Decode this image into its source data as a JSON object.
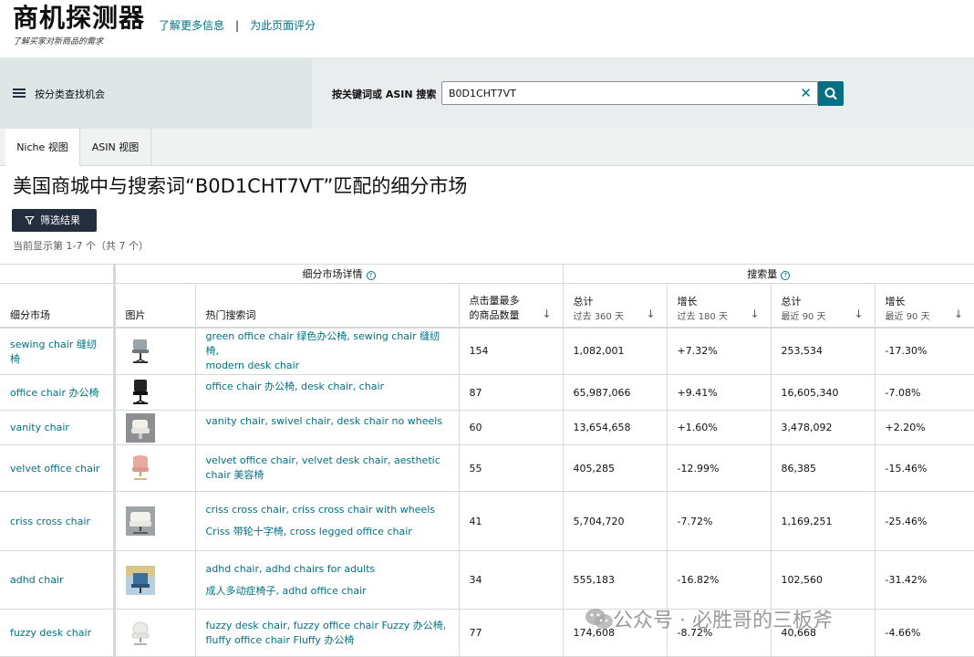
{
  "header": {
    "app_title": "商机探测器",
    "app_subtitle": "了解买家对新商品的需求",
    "link_learn_more": "了解更多信息",
    "separator": "|",
    "link_rate_page": "为此页面评分"
  },
  "search": {
    "category_label": "按分类查找机会",
    "keyword_label": "按关键词或 ASIN 搜索",
    "query_value": "B0D1CHT7VT",
    "clear_symbol": "✕"
  },
  "tabs": [
    {
      "label": "Niche 视图",
      "active": true
    },
    {
      "label": "ASIN 视图",
      "active": false
    }
  ],
  "results": {
    "title": "美国商城中与搜索词“B0D1CHT7VT”匹配的细分市场",
    "filter_button": "筛选结果",
    "showing_text": "当前显示第 1-7 个（共 7 个）"
  },
  "table": {
    "group_headers": {
      "niche_details": "细分市场详情",
      "search_volume": "搜索量"
    },
    "columns": {
      "niche": "细分市场",
      "image": "图片",
      "top_terms": "热门搜索词",
      "most_clicked_1": "点击量最多",
      "most_clicked_2": "的商品数量",
      "total_360": "总计",
      "total_360_sub": "过去 360 天",
      "growth_180": "增长",
      "growth_180_sub": "过去 180 天",
      "total_90": "总计",
      "total_90_sub": "最近 90 天",
      "growth_90": "增长",
      "growth_90_sub": "最近 90 天"
    },
    "rows": [
      {
        "niche": "sewing chair 缝纫椅",
        "terms_1": "green office chair 绿色办公椅, sewing chair 缝纫椅,",
        "terms_2": "modern desk chair",
        "clicked": "154",
        "total_360": "1,082,001",
        "growth_180": "+7.32%",
        "total_90": "253,534",
        "growth_90": "-17.30%"
      },
      {
        "niche": "office chair 办公椅",
        "terms_1": "office chair 办公椅, desk chair, chair",
        "terms_2": "",
        "clicked": "87",
        "total_360": "65,987,066",
        "growth_180": "+9.41%",
        "total_90": "16,605,340",
        "growth_90": "-7.08%"
      },
      {
        "niche": "vanity chair",
        "terms_1": "vanity chair, swivel chair, desk chair no wheels",
        "terms_2": "",
        "clicked": "60",
        "total_360": "13,654,658",
        "growth_180": "+1.60%",
        "total_90": "3,478,092",
        "growth_90": "+2.20%"
      },
      {
        "niche": "velvet office chair",
        "terms_1": "velvet office chair, velvet desk chair, aesthetic",
        "terms_2": "chair 美容椅",
        "clicked": "55",
        "total_360": "405,285",
        "growth_180": "-12.99%",
        "total_90": "86,385",
        "growth_90": "-15.46%"
      },
      {
        "niche": "criss cross chair",
        "terms_1": "criss cross chair, criss cross chair with wheels",
        "terms_2": "Criss 带轮十字椅, cross legged office chair",
        "clicked": "41",
        "total_360": "5,704,720",
        "growth_180": "-7.72%",
        "total_90": "1,169,251",
        "growth_90": "-25.46%"
      },
      {
        "niche": "adhd chair",
        "terms_1": "adhd chair, adhd chairs for adults",
        "terms_2": "成人多动症椅子, adhd office chair",
        "clicked": "34",
        "total_360": "555,183",
        "growth_180": "-16.82%",
        "total_90": "102,560",
        "growth_90": "-31.42%"
      },
      {
        "niche": "fuzzy desk chair",
        "terms_1": "fuzzy desk chair, fuzzy office chair Fuzzy 办公椅,",
        "terms_2": "fluffy office chair Fluffy 办公椅",
        "clicked": "77",
        "total_360": "174,608",
        "growth_180": "-8.72%",
        "total_90": "40,668",
        "growth_90": "-4.66%"
      }
    ]
  },
  "watermark": "公众号 · 必胜哥的三板斧",
  "colors": {
    "link": "#007185",
    "dark_button": "#232f3e",
    "search_button": "#007185",
    "panel_bg": "#dfe6e6",
    "border": "#d5d9d9"
  }
}
